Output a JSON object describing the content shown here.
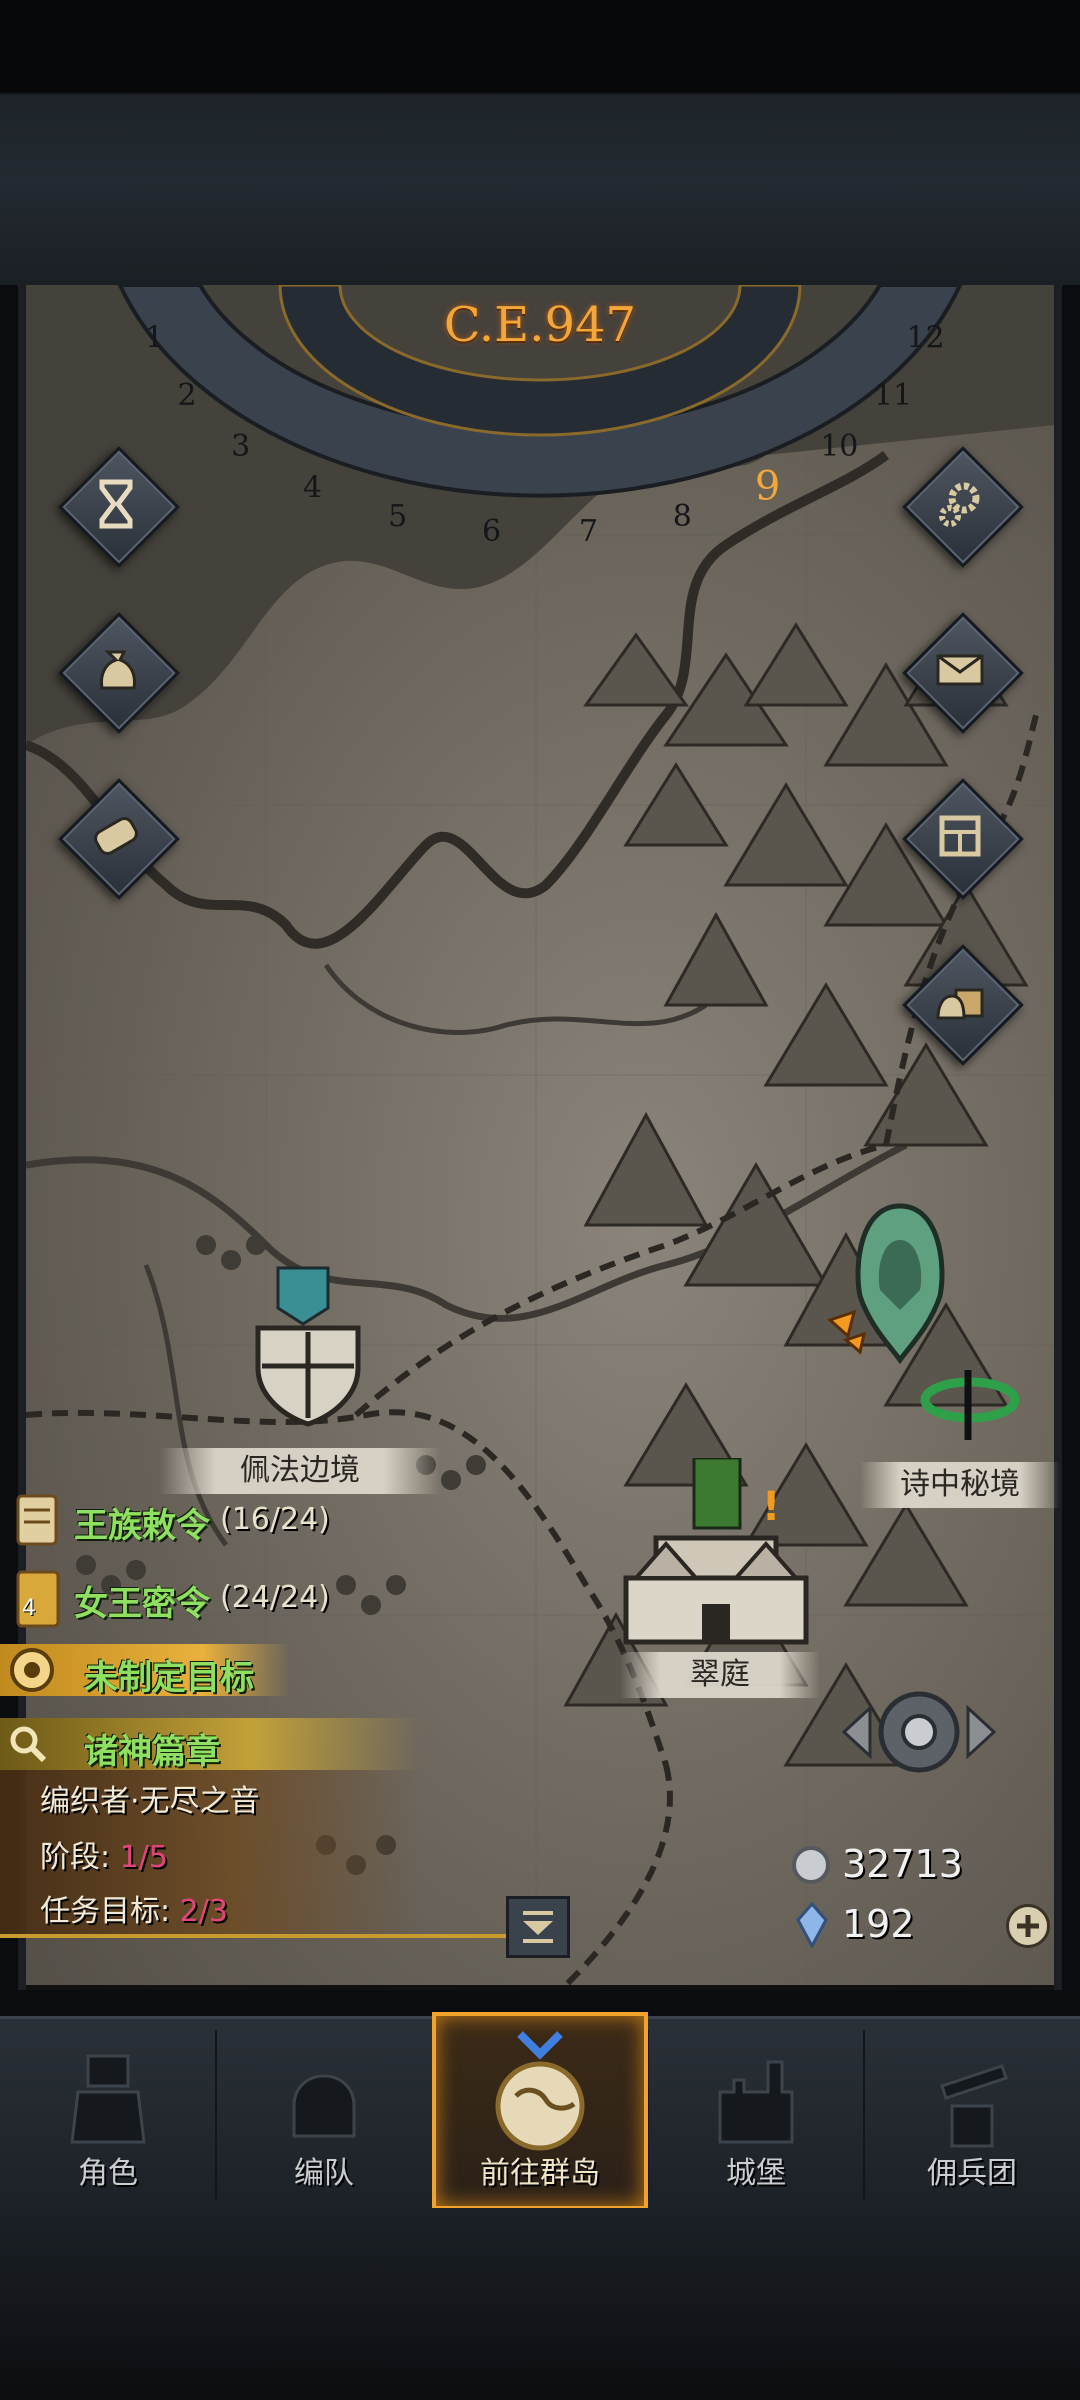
{
  "calendar": {
    "era_label": "C.E.947",
    "months": [
      "1",
      "2",
      "3",
      "4",
      "5",
      "6",
      "7",
      "8",
      "9",
      "10",
      "11",
      "12"
    ],
    "current_month": "9"
  },
  "locations": [
    {
      "label": "佩法边境"
    },
    {
      "label": "诗中秘境"
    },
    {
      "label": "翠庭"
    }
  ],
  "quests": {
    "royal_decree": {
      "label": "王族敕令",
      "count": "(16/24)"
    },
    "queen_order": {
      "label": "女王密令",
      "count": "(24/24)",
      "badge": "4"
    },
    "goal": {
      "label": "未制定目标"
    },
    "chapter": {
      "label": "诸神篇章",
      "name": "编织者·无尽之音",
      "stage_label": "阶段:",
      "stage_value": "1/5",
      "target_label": "任务目标:",
      "target_value": "2/3"
    }
  },
  "currency": {
    "silver": "32713",
    "crystal": "192"
  },
  "side_buttons_left": [
    "hourglass-icon",
    "bag-icon",
    "scroll-icon"
  ],
  "side_buttons_right": [
    "gear-icon",
    "mail-icon",
    "shop-icon",
    "supply-icon"
  ],
  "nav": {
    "items": [
      {
        "label": "角色",
        "icon": "knight-icon"
      },
      {
        "label": "编队",
        "icon": "helmet-icon"
      },
      {
        "label": "前往群岛",
        "icon": "globe-icon",
        "active": true
      },
      {
        "label": "城堡",
        "icon": "castle-icon"
      },
      {
        "label": "佣兵团",
        "icon": "mercenary-icon"
      }
    ]
  },
  "colors": {
    "accent": "#f2a32c",
    "quest_green": "#8fe060",
    "progress_red": "#e0457a",
    "era_gold": "#f3a63a"
  }
}
